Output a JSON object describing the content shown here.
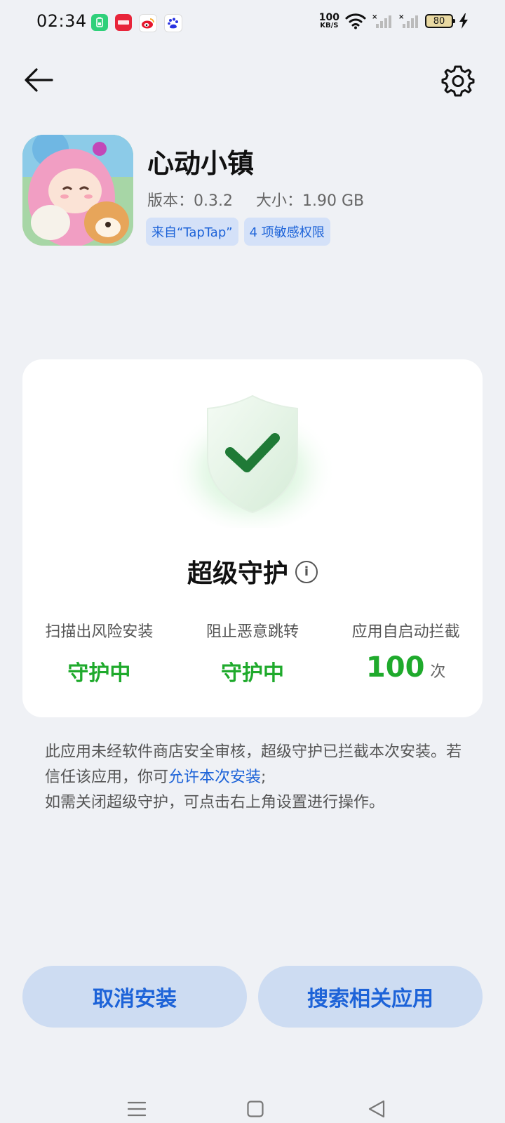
{
  "status_bar": {
    "time": "02:34",
    "net_speed_value": "100",
    "net_speed_unit": "KB/S",
    "battery": "80"
  },
  "header": {
    "back_icon": "arrow-left-icon",
    "settings_icon": "gear-icon"
  },
  "app": {
    "name": "心动小镇",
    "version": "版本：0.3.2",
    "size": "大小：1.90 GB",
    "tags": [
      "来自“TapTap”",
      "4 项敏感权限"
    ]
  },
  "protection": {
    "title": "超级守护",
    "info_icon": "info-icon",
    "stats": [
      {
        "label": "扫描出风险安装",
        "value": "守护中"
      },
      {
        "label": "阻止恶意跳转",
        "value": "守护中"
      },
      {
        "label": "应用自启动拦截",
        "value": "100",
        "unit": "次"
      }
    ],
    "accent_color": "#1faa2c"
  },
  "description": {
    "line1": "此应用未经软件商店安全审核，超级守护已拦截本次安装。若信任该应用，你可",
    "link": "允许本次安装",
    "line1_end": ";",
    "line2": "如需关闭超级守护，可点击右上角设置进行操作。"
  },
  "buttons": {
    "cancel": "取消安装",
    "search": "搜索相关应用"
  },
  "colors": {
    "link": "#1d63d8",
    "button_bg": "#cddcf2",
    "background": "#eff1f5"
  }
}
